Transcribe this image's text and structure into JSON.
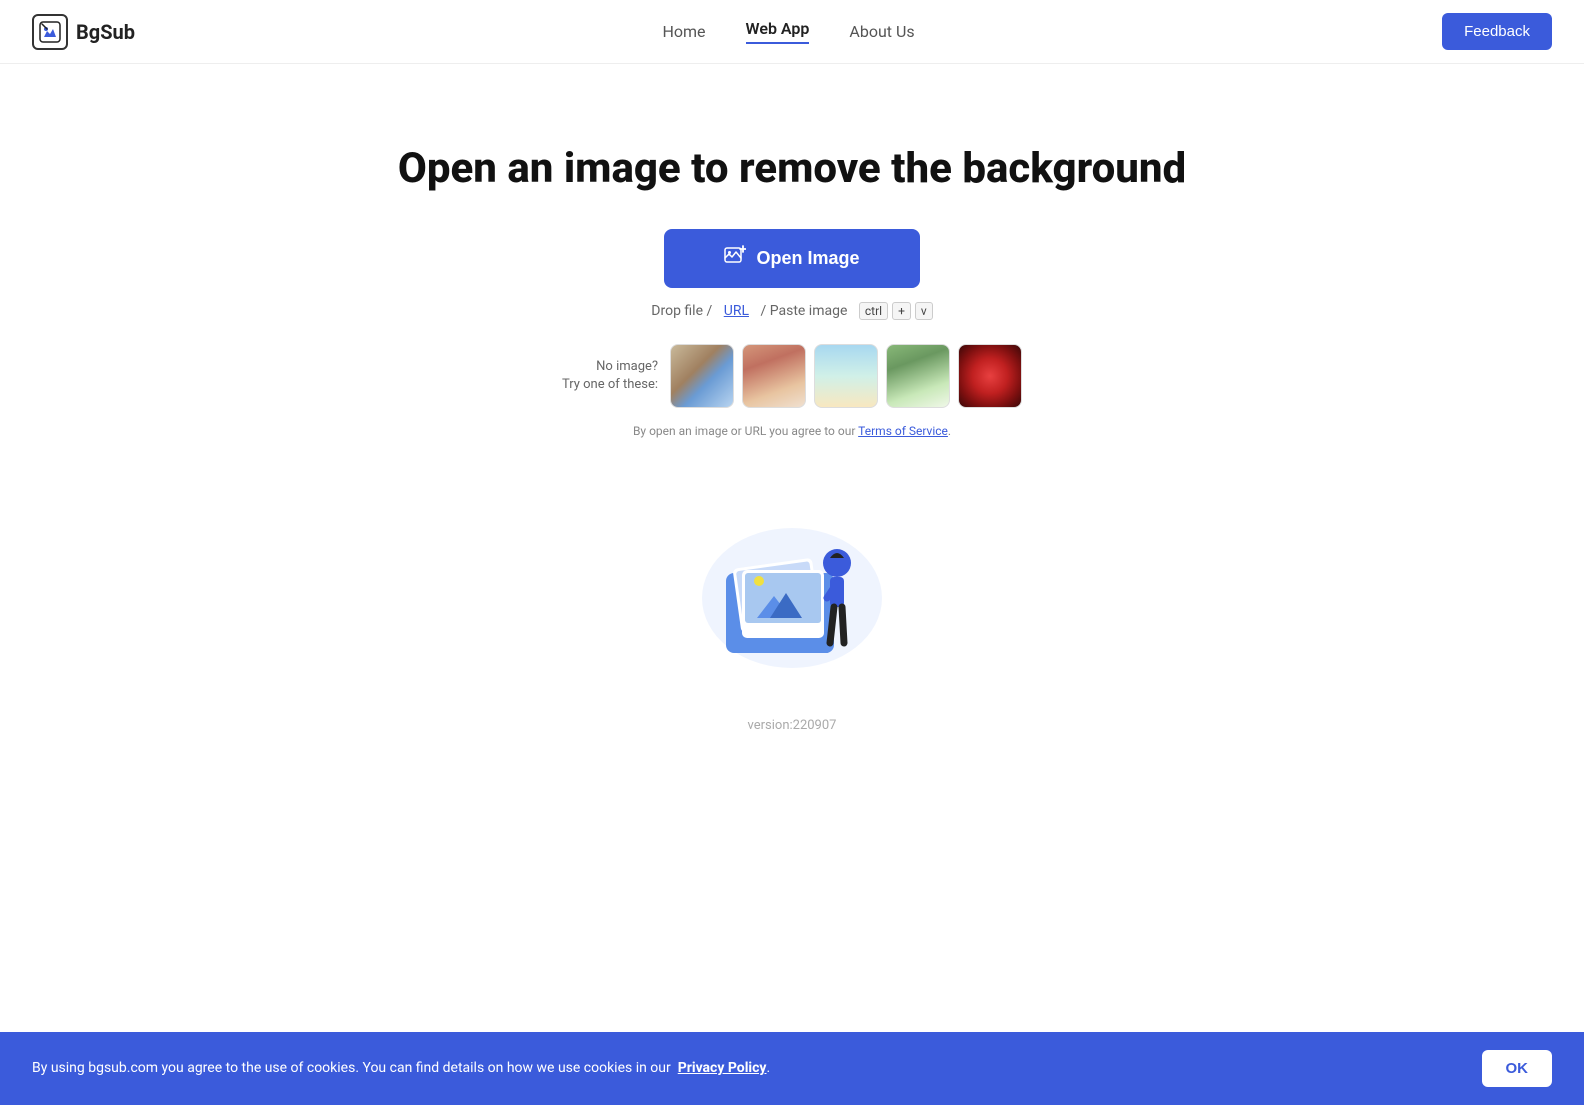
{
  "nav": {
    "logo_text": "BgSub",
    "links": [
      {
        "label": "Home",
        "active": false
      },
      {
        "label": "Web App",
        "active": true
      },
      {
        "label": "About Us",
        "active": false
      }
    ],
    "feedback_label": "Feedback"
  },
  "hero": {
    "title": "Open an image to remove the background",
    "open_button_label": "Open Image",
    "drop_hint_prefix": "Drop file /",
    "drop_hint_url": "URL",
    "drop_hint_middle": "/ Paste image",
    "kbd_ctrl": "ctrl",
    "kbd_plus": "+",
    "kbd_v": "v"
  },
  "samples": {
    "no_image_line1": "No image?",
    "no_image_line2": "Try one of these:",
    "thumbs": [
      "person-outdoors",
      "woman-portrait",
      "hand-gesture",
      "bird",
      "red-rose"
    ]
  },
  "tos": {
    "prefix": "By open an image or URL you agree to our",
    "link_text": "Terms of Service",
    "suffix": "."
  },
  "version": {
    "text": "version:220907"
  },
  "cookie": {
    "text": "By using bgsub.com you agree to the use of cookies. You can find details on how we use cookies in our",
    "link_text": "Privacy Policy",
    "period": ".",
    "ok_label": "OK"
  }
}
